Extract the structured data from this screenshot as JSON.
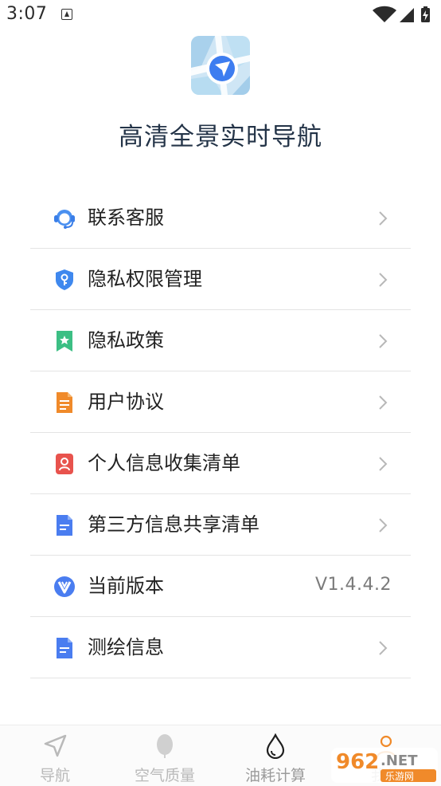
{
  "status_bar": {
    "time": "3:07"
  },
  "app": {
    "title": "高清全景实时导航",
    "logo": "map-navigation-logo"
  },
  "menu": [
    {
      "key": "contact",
      "label": "联系客服",
      "icon": "headset-icon"
    },
    {
      "key": "privacy-permission",
      "label": "隐私权限管理",
      "icon": "shield-key-icon"
    },
    {
      "key": "privacy-policy",
      "label": "隐私政策",
      "icon": "bookmark-star-icon"
    },
    {
      "key": "user-agreement",
      "label": "用户协议",
      "icon": "document-icon"
    },
    {
      "key": "personal-info",
      "label": "个人信息收集清单",
      "icon": "person-card-icon"
    },
    {
      "key": "third-party",
      "label": "第三方信息共享清单",
      "icon": "document-icon"
    },
    {
      "key": "version",
      "label": "当前版本",
      "icon": "v-badge-icon",
      "value": "V1.4.4.2"
    },
    {
      "key": "surveying",
      "label": "测绘信息",
      "icon": "document-icon"
    }
  ],
  "tabs": [
    {
      "label": "导航",
      "icon": "navigation-arrow-icon"
    },
    {
      "label": "空气质量",
      "icon": "leaf-icon"
    },
    {
      "label": "油耗计算",
      "icon": "drop-icon",
      "active": true
    },
    {
      "label": "我的",
      "icon": "person-icon"
    }
  ],
  "watermark": {
    "text": "962.NET",
    "subtext": "乐游网"
  },
  "colors": {
    "title": "#243448",
    "blue": "#4a7df0",
    "orange": "#f08a2a",
    "red": "#e8534d",
    "green": "#3cbf84"
  }
}
